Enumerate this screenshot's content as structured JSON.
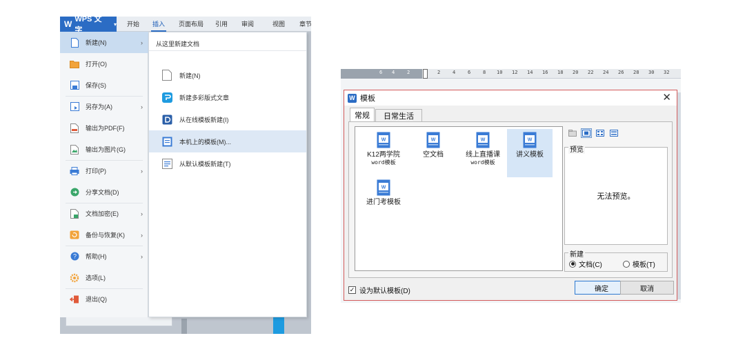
{
  "left": {
    "app_title": "WPS 文字",
    "top_tabs": [
      {
        "label": "开始"
      },
      {
        "label": "插入",
        "active": true
      },
      {
        "label": "页面布局"
      },
      {
        "label": "引用"
      },
      {
        "label": "审阅"
      },
      {
        "label": "视图"
      },
      {
        "label": "章节"
      }
    ],
    "menu_items": [
      {
        "label": "新建(N)",
        "icon": "new-doc-icon",
        "submenu": true,
        "active": true
      },
      {
        "label": "打开(O)",
        "icon": "folder-open-icon"
      },
      {
        "label": "保存(S)",
        "icon": "save-icon"
      },
      {
        "label": "另存为(A)",
        "icon": "save-as-icon",
        "submenu": true
      },
      {
        "label": "输出为PDF(F)",
        "icon": "pdf-icon"
      },
      {
        "label": "输出为图片(G)",
        "icon": "image-export-icon"
      },
      {
        "label": "打印(P)",
        "icon": "print-icon",
        "submenu": true
      },
      {
        "label": "分享文档(D)",
        "icon": "share-icon"
      },
      {
        "label": "文档加密(E)",
        "icon": "lock-icon",
        "submenu": true
      },
      {
        "label": "备份与恢复(K)",
        "icon": "backup-icon",
        "submenu": true
      },
      {
        "label": "帮助(H)",
        "icon": "help-icon",
        "submenu": true
      },
      {
        "label": "选项(L)",
        "icon": "options-gear-icon"
      },
      {
        "label": "退出(Q)",
        "icon": "exit-icon"
      }
    ],
    "submenu": {
      "header": "从这里新建文档",
      "items": [
        {
          "label": "新建(N)",
          "icon": "blank-doc-icon"
        },
        {
          "label": "新建多彩版式文章",
          "icon": "colorful-layout-icon"
        },
        {
          "label": "从在线模板新建(I)",
          "icon": "online-template-icon"
        },
        {
          "label": "本机上的模板(M)...",
          "icon": "local-template-icon",
          "active": true
        },
        {
          "label": "从默认模板新建(T)",
          "icon": "default-template-icon"
        }
      ]
    }
  },
  "right": {
    "ruler_ticks": [
      "6",
      "4",
      "2",
      "2",
      "4",
      "6",
      "8",
      "10",
      "12",
      "14",
      "16",
      "18",
      "20",
      "22",
      "24",
      "26",
      "28",
      "30",
      "32"
    ],
    "dialog": {
      "title": "模板",
      "close_glyph": "✕",
      "tabs": [
        {
          "label": "常规",
          "active": true
        },
        {
          "label": "日常生活"
        }
      ],
      "templates": [
        {
          "line1": "K12两学院",
          "line2": "word模板"
        },
        {
          "line1": "空文档",
          "line2": ""
        },
        {
          "line1": "线上直播课",
          "line2": "word模板"
        },
        {
          "line1": "讲义模板",
          "line2": "",
          "selected": true
        },
        {
          "line1": "进门考模板",
          "line2": ""
        }
      ],
      "preview_label": "预览",
      "preview_text": "无法预览。",
      "new_label": "新建",
      "radio_document": "文档(C)",
      "radio_template": "模板(T)",
      "radio_selected": "document",
      "default_checkbox": "设为默认模板(D)",
      "default_checked": true,
      "ok_button": "确定",
      "cancel_button": "取消"
    }
  },
  "colors": {
    "accent_blue": "#2b6cc4",
    "menu_active": "#c9dcf0",
    "dialog_border": "#d35a5a",
    "selected_template": "#d6e6f7",
    "blue_strip": "#1e9be0"
  }
}
